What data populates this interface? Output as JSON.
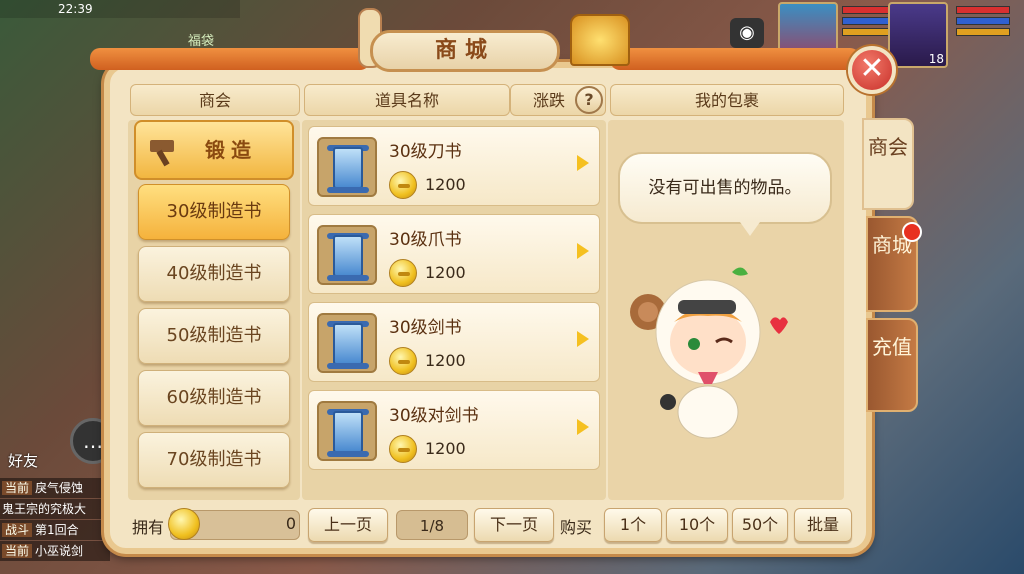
{
  "status": {
    "time": "22:39"
  },
  "background": {
    "label": "福袋",
    "friend": "好友",
    "chat": [
      {
        "tag": "当前",
        "text": "戾气侵蚀"
      },
      {
        "tag": "",
        "text": "鬼王宗的究极大"
      },
      {
        "tag": "战斗",
        "text": "第1回合"
      },
      {
        "tag": "当前",
        "text": "小巫说剑"
      }
    ],
    "portraits": [
      {
        "level": ""
      },
      {
        "level": "18"
      }
    ]
  },
  "shop": {
    "title": "商城",
    "columns": {
      "guild": "商会",
      "item_name": "道具名称",
      "price_change": "涨跌",
      "my_bag": "我的包裹"
    },
    "forge": "锻造",
    "categories": [
      {
        "label": "30级制造书",
        "active": true
      },
      {
        "label": "40级制造书",
        "active": false
      },
      {
        "label": "50级制造书",
        "active": false
      },
      {
        "label": "60级制造书",
        "active": false
      },
      {
        "label": "70级制造书",
        "active": false
      }
    ],
    "items": [
      {
        "name": "30级刀书",
        "price": "1200"
      },
      {
        "name": "30级爪书",
        "price": "1200"
      },
      {
        "name": "30级剑书",
        "price": "1200"
      },
      {
        "name": "30级对剑书",
        "price": "1200"
      }
    ],
    "bag_message": "没有可出售的物品。",
    "side_tabs": [
      "商会",
      "商城",
      "充值"
    ],
    "footer": {
      "owned_label": "拥有",
      "owned_value": "0",
      "prev": "上一页",
      "page": "1/8",
      "next": "下一页",
      "buy_label": "购买",
      "qty": [
        "1个",
        "10个",
        "50个"
      ],
      "bulk": "批量"
    }
  }
}
